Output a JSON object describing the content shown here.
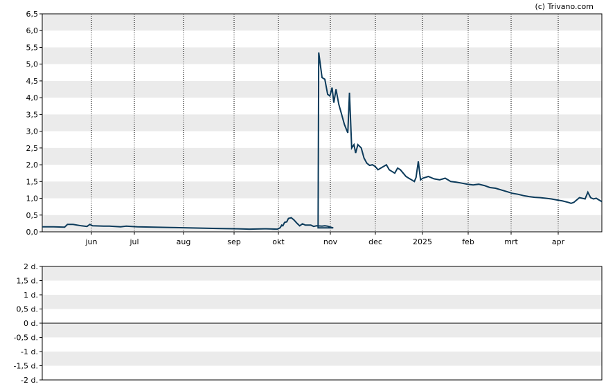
{
  "copyright": "(c) Trivano.com",
  "chart_data": [
    {
      "type": "line",
      "title": "",
      "xlabel": "",
      "ylabel": "",
      "ylim": [
        0,
        6.5
      ],
      "y_ticks": [
        "0,0",
        "0,5",
        "1,0",
        "1,5",
        "2,0",
        "2,5",
        "3,0",
        "3,5",
        "4,0",
        "4,5",
        "5,0",
        "5,5",
        "6,0",
        "6,5"
      ],
      "x_ticks": [
        "jun",
        "jul",
        "aug",
        "sep",
        "okt",
        "nov",
        "dec",
        "2025",
        "feb",
        "mrt",
        "apr"
      ],
      "grid": "horizontal bands, dotted vertical lines at month ticks",
      "colors": {
        "line": "#0b3a5a",
        "band": "#ebebeb"
      },
      "series": [
        {
          "values": [
            [
              0.0,
              0.15
            ],
            [
              0.02,
              0.15
            ],
            [
              0.04,
              0.14
            ],
            [
              0.045,
              0.22
            ],
            [
              0.055,
              0.22
            ],
            [
              0.07,
              0.18
            ],
            [
              0.08,
              0.16
            ],
            [
              0.085,
              0.22
            ],
            [
              0.09,
              0.18
            ],
            [
              0.11,
              0.17
            ],
            [
              0.12,
              0.17
            ],
            [
              0.14,
              0.15
            ],
            [
              0.15,
              0.17
            ],
            [
              0.17,
              0.15
            ],
            [
              0.2,
              0.14
            ],
            [
              0.23,
              0.13
            ],
            [
              0.26,
              0.12
            ],
            [
              0.29,
              0.11
            ],
            [
              0.32,
              0.1
            ],
            [
              0.35,
              0.09
            ],
            [
              0.37,
              0.08
            ],
            [
              0.4,
              0.09
            ],
            [
              0.42,
              0.08
            ],
            [
              0.41,
              0.08
            ],
            [
              0.41,
              0.08
            ],
            [
              0.415,
              0.08
            ],
            [
              0.42,
              0.08
            ],
            [
              0.425,
              0.12
            ],
            [
              0.428,
              0.2
            ],
            [
              0.43,
              0.18
            ],
            [
              0.433,
              0.28
            ],
            [
              0.437,
              0.3
            ],
            [
              0.44,
              0.4
            ],
            [
              0.445,
              0.42
            ],
            [
              0.45,
              0.35
            ],
            [
              0.455,
              0.26
            ],
            [
              0.46,
              0.18
            ],
            [
              0.465,
              0.24
            ],
            [
              0.47,
              0.2
            ],
            [
              0.48,
              0.2
            ],
            [
              0.485,
              0.16
            ],
            [
              0.49,
              0.18
            ],
            [
              0.5,
              0.17
            ],
            [
              0.505,
              0.18
            ],
            [
              0.51,
              0.17
            ],
            [
              0.515,
              0.14
            ],
            [
              0.52,
              0.12
            ],
            [
              0.493,
              0.12
            ],
            [
              0.494,
              5.35
            ],
            [
              0.5,
              4.6
            ],
            [
              0.505,
              4.55
            ],
            [
              0.51,
              4.1
            ],
            [
              0.514,
              4.05
            ],
            [
              0.518,
              4.3
            ],
            [
              0.521,
              3.85
            ],
            [
              0.525,
              4.25
            ],
            [
              0.53,
              3.8
            ],
            [
              0.535,
              3.5
            ],
            [
              0.54,
              3.2
            ],
            [
              0.546,
              2.95
            ],
            [
              0.549,
              4.15
            ],
            [
              0.553,
              2.5
            ],
            [
              0.557,
              2.6
            ],
            [
              0.56,
              2.35
            ],
            [
              0.564,
              2.6
            ],
            [
              0.57,
              2.5
            ],
            [
              0.575,
              2.2
            ],
            [
              0.58,
              2.05
            ],
            [
              0.585,
              1.98
            ],
            [
              0.59,
              2.0
            ],
            [
              0.595,
              1.95
            ],
            [
              0.6,
              1.85
            ],
            [
              0.605,
              1.9
            ],
            [
              0.61,
              1.95
            ],
            [
              0.615,
              2.0
            ],
            [
              0.62,
              1.85
            ],
            [
              0.625,
              1.8
            ],
            [
              0.63,
              1.75
            ],
            [
              0.635,
              1.9
            ],
            [
              0.64,
              1.85
            ],
            [
              0.645,
              1.75
            ],
            [
              0.65,
              1.65
            ],
            [
              0.655,
              1.6
            ],
            [
              0.66,
              1.55
            ],
            [
              0.665,
              1.5
            ],
            [
              0.668,
              1.62
            ],
            [
              0.672,
              2.1
            ],
            [
              0.676,
              1.55
            ],
            [
              0.68,
              1.6
            ],
            [
              0.69,
              1.65
            ],
            [
              0.7,
              1.58
            ],
            [
              0.71,
              1.55
            ],
            [
              0.72,
              1.6
            ],
            [
              0.725,
              1.55
            ],
            [
              0.73,
              1.5
            ],
            [
              0.74,
              1.48
            ],
            [
              0.75,
              1.45
            ],
            [
              0.76,
              1.42
            ],
            [
              0.77,
              1.4
            ],
            [
              0.78,
              1.42
            ],
            [
              0.79,
              1.38
            ],
            [
              0.8,
              1.32
            ],
            [
              0.81,
              1.3
            ],
            [
              0.82,
              1.25
            ],
            [
              0.83,
              1.2
            ],
            [
              0.84,
              1.15
            ],
            [
              0.85,
              1.12
            ],
            [
              0.86,
              1.08
            ],
            [
              0.87,
              1.05
            ],
            [
              0.88,
              1.03
            ],
            [
              0.89,
              1.02
            ],
            [
              0.9,
              1.0
            ],
            [
              0.91,
              0.98
            ],
            [
              0.92,
              0.95
            ],
            [
              0.93,
              0.92
            ],
            [
              0.94,
              0.88
            ],
            [
              0.945,
              0.85
            ],
            [
              0.95,
              0.88
            ],
            [
              0.955,
              0.95
            ],
            [
              0.96,
              1.02
            ],
            [
              0.965,
              1.0
            ],
            [
              0.97,
              0.98
            ],
            [
              0.975,
              1.18
            ],
            [
              0.98,
              1.02
            ],
            [
              0.985,
              0.98
            ],
            [
              0.99,
              1.0
            ],
            [
              0.995,
              0.95
            ],
            [
              1.0,
              0.9
            ]
          ]
        }
      ]
    },
    {
      "type": "line",
      "title": "",
      "xlabel": "",
      "ylabel": "",
      "ylim": [
        -2,
        2
      ],
      "y_ticks": [
        "2 d.",
        "1,5 d.",
        "1 d.",
        "0,5 d.",
        "0 d.",
        "-0,5 d.",
        "-1 d.",
        "-1,5 d.",
        "-2 d."
      ],
      "x_ticks": [],
      "grid": "horizontal bands",
      "series": []
    }
  ]
}
